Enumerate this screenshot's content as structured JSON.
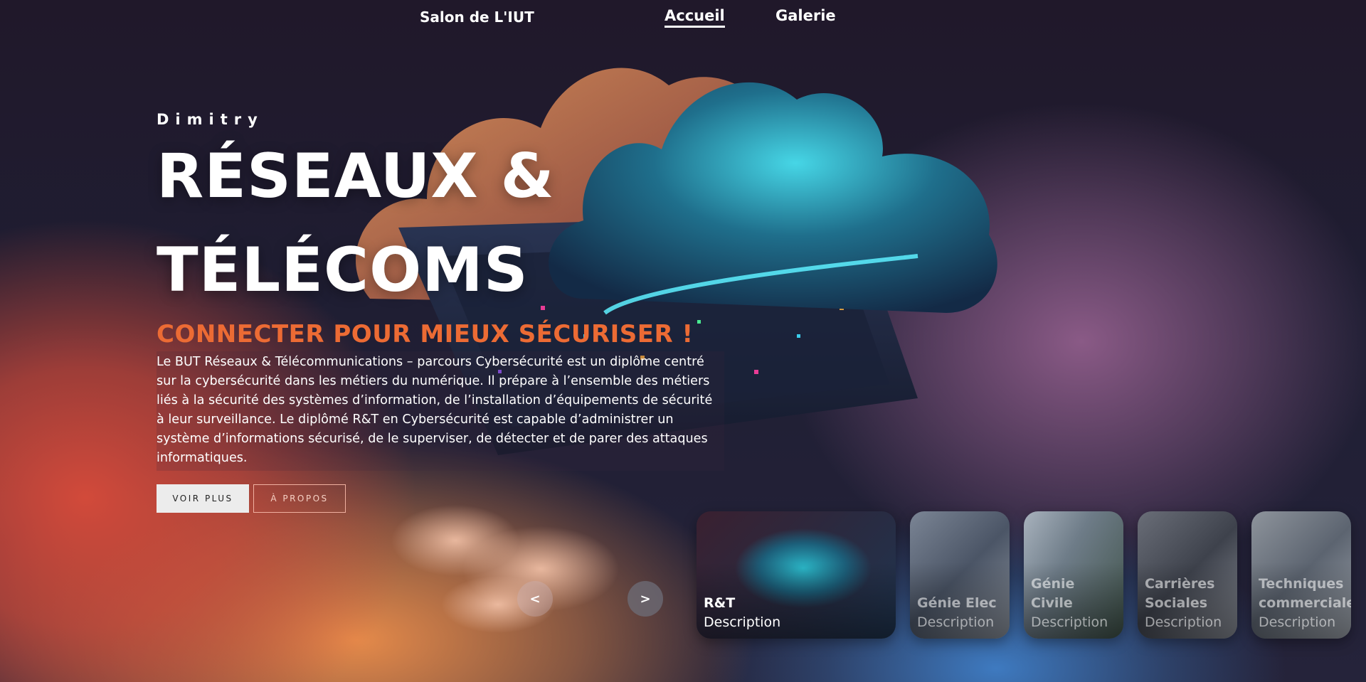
{
  "nav": {
    "brand": "Salon de L'IUT",
    "links": [
      {
        "label": "Accueil",
        "active": true
      },
      {
        "label": "Galerie",
        "active": false
      }
    ]
  },
  "hero": {
    "author": "Dimitry",
    "title_line1": "RÉSEAUX &",
    "title_line2": "TÉLÉCOMS",
    "tagline": "CONNECTER POUR MIEUX SÉCURISER !",
    "description": "Le BUT Réseaux & Télécommunications – parcours Cybersécurité est un diplôme centré sur la cybersécurité dans les métiers du numérique. Il prépare à l’ensemble des métiers liés à la sécurité des systèmes d’information, de l’installation d’équipements de sécurité à leur surveillance. Le diplômé R&T en Cybersécurité est capable d’administrer un système d’informations sécurisé, de le superviser, de détecter et de parer des attaques informatiques.",
    "primary_button": "VOIR PLUS",
    "secondary_button": "À PROPOS"
  },
  "carousel": {
    "prev": "<",
    "next": ">",
    "cards": [
      {
        "name": "R&T",
        "description": "Description"
      },
      {
        "name": "Génie Elec",
        "description": "Description"
      },
      {
        "name": "Génie Civile",
        "description": "Description"
      },
      {
        "name": "Carrières Sociales",
        "description": "Description"
      },
      {
        "name": "Techniques commerciales",
        "description": "Description"
      }
    ]
  },
  "colors": {
    "accent": "#ec6b34",
    "primary_button_bg": "#ececec"
  }
}
